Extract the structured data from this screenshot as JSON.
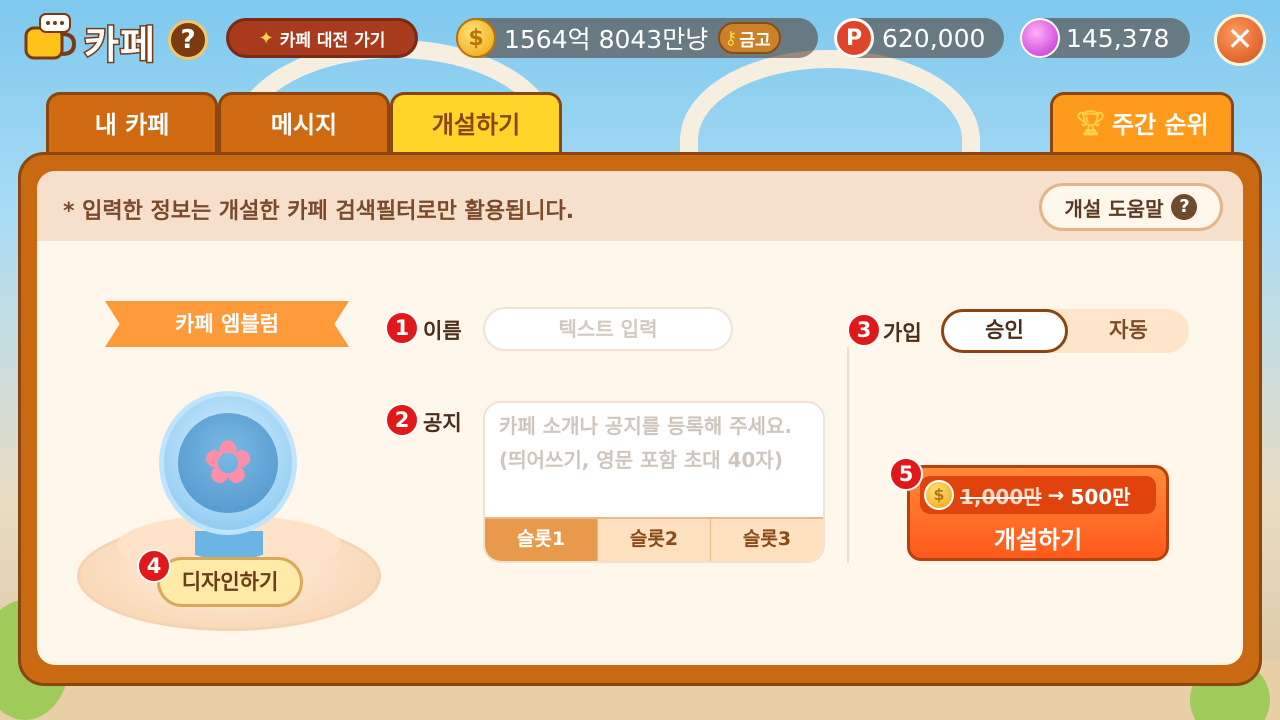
{
  "header": {
    "title": "카페",
    "help": "?",
    "battle_label": "카페 대전 가기",
    "gold_amount": "1564억 8043만냥",
    "vault_label": "금고",
    "points_amount": "620,000",
    "gems_amount": "145,378",
    "close": "✕"
  },
  "tabs": [
    {
      "label": "내 카페",
      "active": false
    },
    {
      "label": "메시지",
      "active": false
    },
    {
      "label": "개설하기",
      "active": true
    }
  ],
  "rank_tab": {
    "label": "주간 순위"
  },
  "info": {
    "text": "* 입력한 정보는 개설한 카페 검색필터로만 활용됩니다.",
    "guide_label": "개설 도움말",
    "guide_icon": "?"
  },
  "emblem": {
    "title": "카페 엠블럼",
    "design_label": "디자인하기",
    "step": "4"
  },
  "name_field": {
    "step": "1",
    "label": "이름",
    "placeholder": "텍스트 입력"
  },
  "notice_field": {
    "step": "2",
    "label": "공지",
    "placeholder": "카페 소개나 공지를 등록해 주세요. (띄어쓰기, 영문 포함 초대 40자)",
    "slots": [
      "슬롯1",
      "슬롯2",
      "슬롯3"
    ],
    "active_slot": 0
  },
  "join_field": {
    "step": "3",
    "label": "가입",
    "options": [
      "승인",
      "자동"
    ],
    "selected": "승인"
  },
  "open_button": {
    "step": "5",
    "old_price": "1,000만",
    "new_price": "500만",
    "label": "개설하기"
  },
  "colors": {
    "accent_orange": "#c96a12",
    "active_tab": "#ffd52a",
    "step_badge": "#e01818",
    "open_button": "#ff5a1a"
  }
}
